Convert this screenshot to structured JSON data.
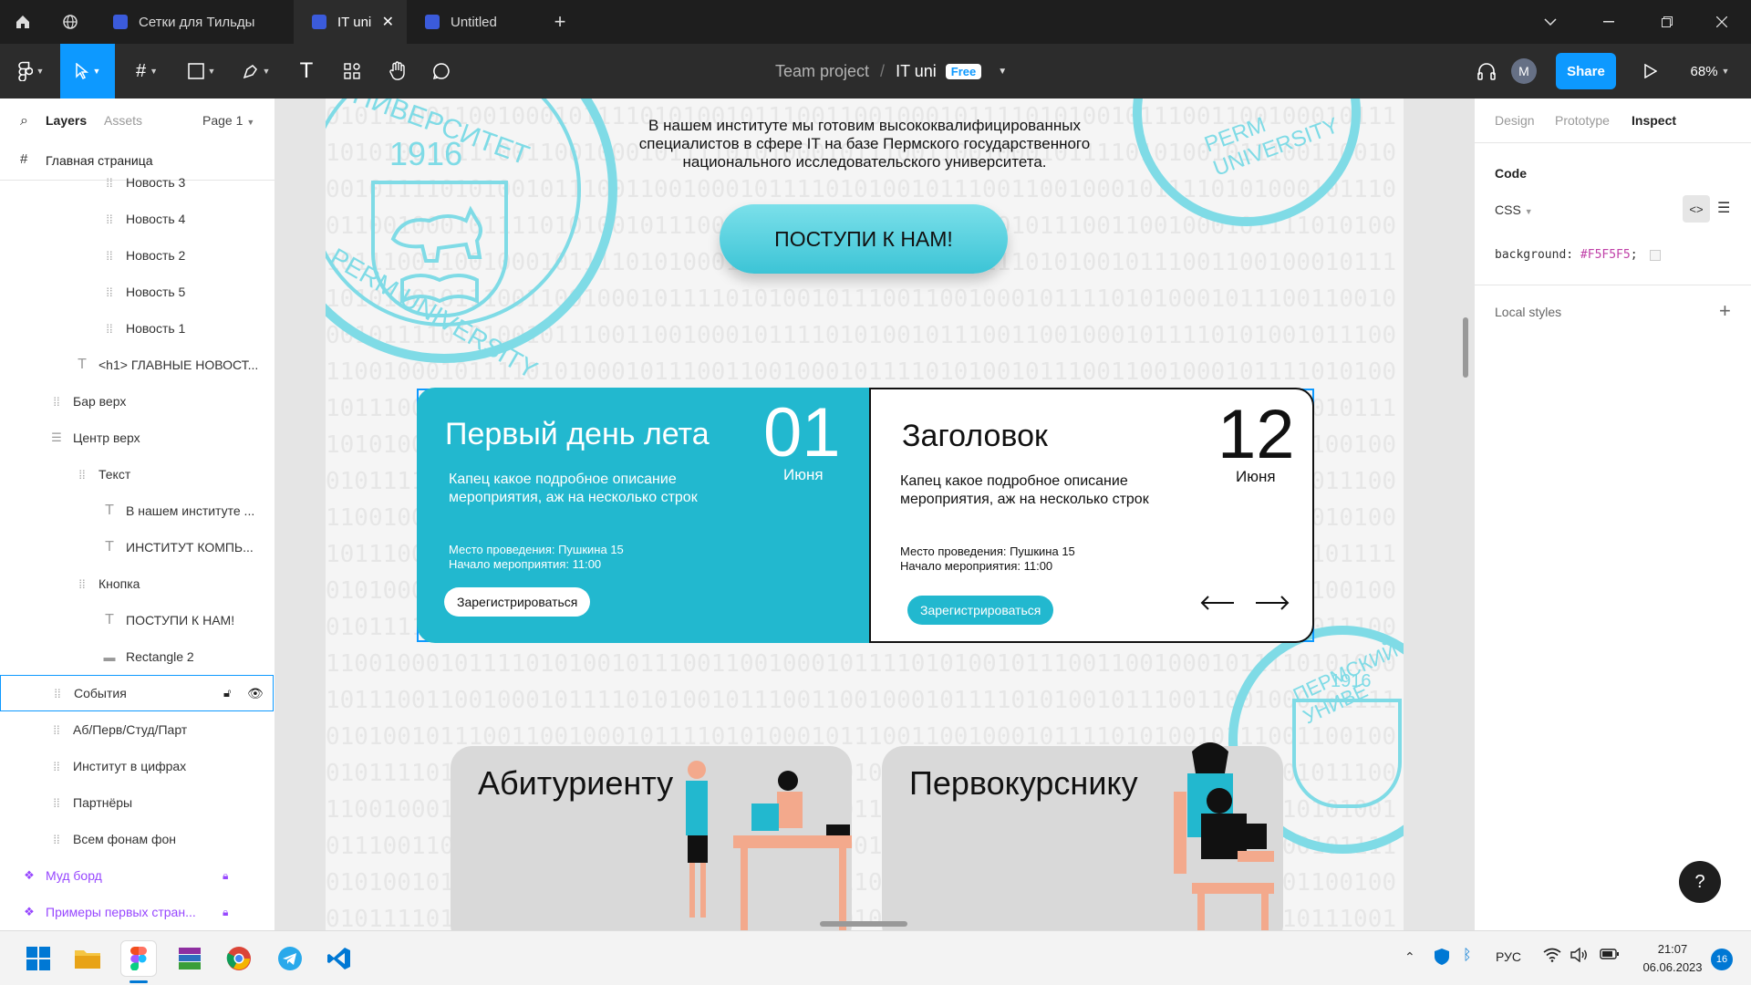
{
  "titlebar": {
    "tabs": [
      {
        "label": "Сетки для Тильды"
      },
      {
        "label": "IT uni"
      },
      {
        "label": "Untitled"
      }
    ]
  },
  "toolbar": {
    "breadcrumb_team": "Team project",
    "separator": "/",
    "file_name": "IT uni",
    "plan_badge": "Free",
    "avatar_initial": "M",
    "share_label": "Share",
    "zoom": "68%"
  },
  "layers_panel": {
    "tab_layers": "Layers",
    "tab_assets": "Assets",
    "page_selector": "Page 1",
    "page_name": "Главная страница",
    "items": [
      {
        "label": "Новость 3",
        "icon": "frame-icon"
      },
      {
        "label": "Новость 4",
        "icon": "frame-icon"
      },
      {
        "label": "Новость 2",
        "icon": "frame-icon"
      },
      {
        "label": "Новость 5",
        "icon": "frame-icon"
      },
      {
        "label": "Новость 1",
        "icon": "frame-icon"
      },
      {
        "label": "<h1> ГЛАВНЫЕ НОВОСТ...",
        "icon": "text-icon"
      },
      {
        "label": "Бар верх",
        "icon": "frame-icon"
      },
      {
        "label": "Центр верх",
        "icon": "autolayout-icon"
      },
      {
        "label": "Текст",
        "icon": "frame-icon"
      },
      {
        "label": "В нашем институте ...",
        "icon": "text-icon"
      },
      {
        "label": "ИНСТИТУТ КОМПЬ...",
        "icon": "text-icon"
      },
      {
        "label": "Кнопка",
        "icon": "frame-icon"
      },
      {
        "label": "ПОСТУПИ К НАМ!",
        "icon": "text-icon"
      },
      {
        "label": "Rectangle 2",
        "icon": "rectangle-icon"
      },
      {
        "label": "События",
        "icon": "frame-icon"
      },
      {
        "label": "Аб/Перв/Студ/Парт",
        "icon": "frame-icon"
      },
      {
        "label": "Институт в цифрах",
        "icon": "frame-icon"
      },
      {
        "label": "Партнёры",
        "icon": "frame-icon"
      },
      {
        "label": "Всем фонам фон",
        "icon": "frame-icon"
      },
      {
        "label": "Муд борд",
        "icon": "component-icon"
      },
      {
        "label": "Примеры первых стран...",
        "icon": "component-icon"
      }
    ]
  },
  "canvas": {
    "intro_text": "В нашем институте мы готовим высококвалифицированных специалистов в сфере IT на базе Пермского государственного национального исследовательского университета.",
    "cta_button": "ПОСТУПИ К НАМ!",
    "seal_year": "1916",
    "seal_ru": "СКИЙ УНИВЕРСИТЕТ",
    "seal_en": "PERM UNIVERSITY",
    "seal_small_ru": "ПЕРМСКИЙ УНИВЕ",
    "binary_digits": "0101110011001000101111010100101110011001000101111010100101110011001000101111010100101110011001000101111010100",
    "event1": {
      "title": "Первый день лета",
      "day": "01",
      "month": "Июня",
      "description": "Капец какое подробное описание мероприятия, аж на несколько строк",
      "place": "Место проведения: Пушкина 15",
      "start": "Начало мероприятия: 11:00",
      "button": "Зарегистрироваться"
    },
    "event2": {
      "title": "Заголовок",
      "day": "12",
      "month": "Июня",
      "description": "Капец какое подробное описание мероприятия, аж на несколько строк",
      "place": "Место проведения: Пушкина 15",
      "start": "Начало мероприятия: 11:00",
      "button": "Зарегистрироваться"
    },
    "card_applicant": "Абитуриенту",
    "card_freshman": "Первокурснику"
  },
  "right_panel": {
    "tabs": [
      "Design",
      "Prototype",
      "Inspect"
    ],
    "code_heading": "Code",
    "language": "CSS",
    "css_property": "background:",
    "css_value": "#F5F5F5",
    "css_semicolon": ";",
    "local_styles": "Local styles"
  },
  "taskbar": {
    "language": "РУС",
    "time": "21:07",
    "date": "06.06.2023",
    "notifications": "16"
  },
  "colors": {
    "accent": "#0d99ff",
    "teal": "#22b8cf",
    "component_purple": "#9747ff"
  }
}
